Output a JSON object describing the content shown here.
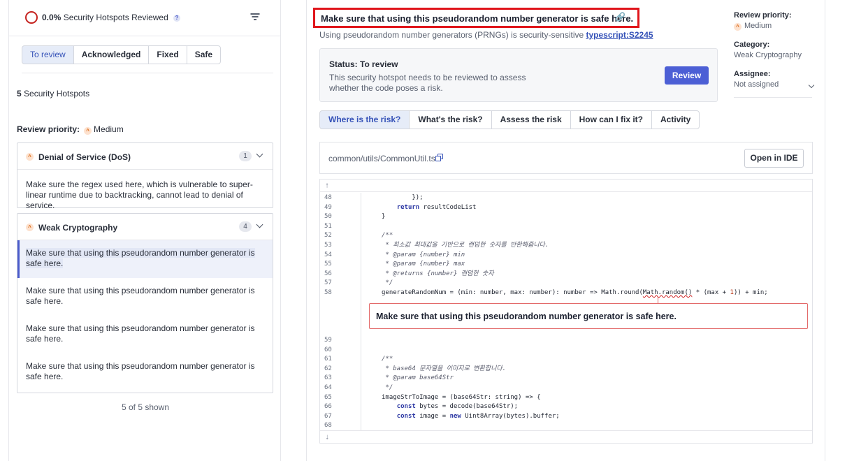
{
  "summary": {
    "percent": "0.0%",
    "label": "Security Hotspots Reviewed",
    "help": "?"
  },
  "filters": [
    "To review",
    "Acknowledged",
    "Fixed",
    "Safe"
  ],
  "count": {
    "number": "5",
    "label": "Security Hotspots"
  },
  "review_priority": {
    "label": "Review priority:",
    "value": "Medium"
  },
  "groups": [
    {
      "title": "Denial of Service (DoS)",
      "count": "1",
      "items": [
        "Make sure the regex used here, which is vulnerable to super-linear runtime due to backtracking, cannot lead to denial of service."
      ]
    },
    {
      "title": "Weak Cryptography",
      "count": "4",
      "items": [
        "Make sure that using this pseudorandom number generator is safe here.",
        "Make sure that using this pseudorandom number generator is safe here.",
        "Make sure that using this pseudorandom number generator is safe here.",
        "Make sure that using this pseudorandom number generator is safe here."
      ]
    }
  ],
  "shown": "5 of 5 shown",
  "hotspot": {
    "title": "Make sure that using this pseudorandom number generator is safe here.",
    "subtitle": "Using pseudorandom number generators (PRNGs) is security-sensitive",
    "rule": "typescript:S2245",
    "status_label": "Status: To review",
    "status_desc": "This security hotspot needs to be reviewed to assess whether the code poses a risk.",
    "review_button": "Review"
  },
  "detail_tabs": [
    "Where is the risk?",
    "What's the risk?",
    "Assess the risk",
    "How can I fix it?",
    "Activity"
  ],
  "file": {
    "path": "common/utils/CommonUtil.ts",
    "open_ide": "Open in IDE"
  },
  "code": {
    "issue_message": "Make sure that using this pseudorandom number generator is safe here.",
    "expand_up": "⭡",
    "expand_down": "⭣",
    "lines_before": [
      {
        "n": "48",
        "text": "            });"
      },
      {
        "n": "49",
        "text": "        return resultCodeList"
      },
      {
        "n": "50",
        "text": "    }"
      },
      {
        "n": "51",
        "text": ""
      },
      {
        "n": "52",
        "text": "    /**"
      },
      {
        "n": "53",
        "text": "     * 최소값 최대값을 기반으로 랜덤한 숫자를 반환해줍니다."
      },
      {
        "n": "54",
        "text": "     * @param {number} min"
      },
      {
        "n": "55",
        "text": "     * @param {number} max"
      },
      {
        "n": "56",
        "text": "     * @returns {number} 랜덤한 숫자"
      },
      {
        "n": "57",
        "text": "     */"
      },
      {
        "n": "58",
        "text": "    generateRandomNum = (min: number, max: number): number => Math.round(Math.random() * (max + 1)) + min;"
      }
    ],
    "lines_after": [
      {
        "n": "59",
        "text": ""
      },
      {
        "n": "60",
        "text": ""
      },
      {
        "n": "61",
        "text": "    /**"
      },
      {
        "n": "62",
        "text": "     * base64 문자열을 이미지로 변환합니다."
      },
      {
        "n": "63",
        "text": "     * @param base64Str"
      },
      {
        "n": "64",
        "text": "     */"
      },
      {
        "n": "65",
        "text": "    imageStrToImage = (base64Str: string) => {"
      },
      {
        "n": "66",
        "text": "        const bytes = decode(base64Str);"
      },
      {
        "n": "67",
        "text": "        const image = new Uint8Array(bytes).buffer;"
      },
      {
        "n": "68",
        "text": ""
      }
    ]
  },
  "meta": {
    "priority_label": "Review priority:",
    "priority_value": "Medium",
    "category_label": "Category:",
    "category_value": "Weak Cryptography",
    "assignee_label": "Assignee:",
    "assignee_value": "Not assigned"
  }
}
